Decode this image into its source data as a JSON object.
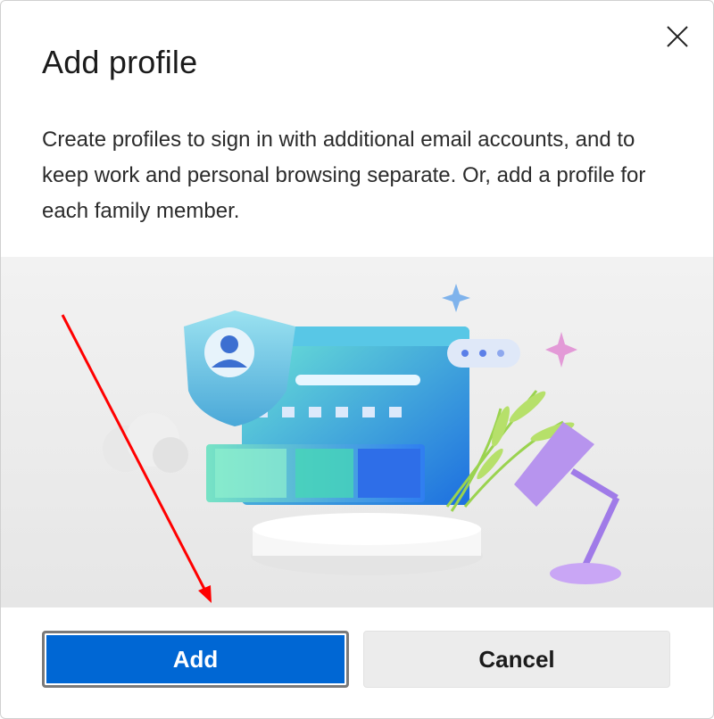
{
  "dialog": {
    "title": "Add profile",
    "description": "Create profiles to sign in with additional email accounts, and to keep work and personal browsing separate. Or, add a profile for each family member.",
    "close_icon": "close-icon",
    "illustration": "profile-illustration",
    "buttons": {
      "add_label": "Add",
      "cancel_label": "Cancel"
    }
  },
  "colors": {
    "primary": "#0067d4",
    "annotation_arrow": "#ff0000"
  }
}
